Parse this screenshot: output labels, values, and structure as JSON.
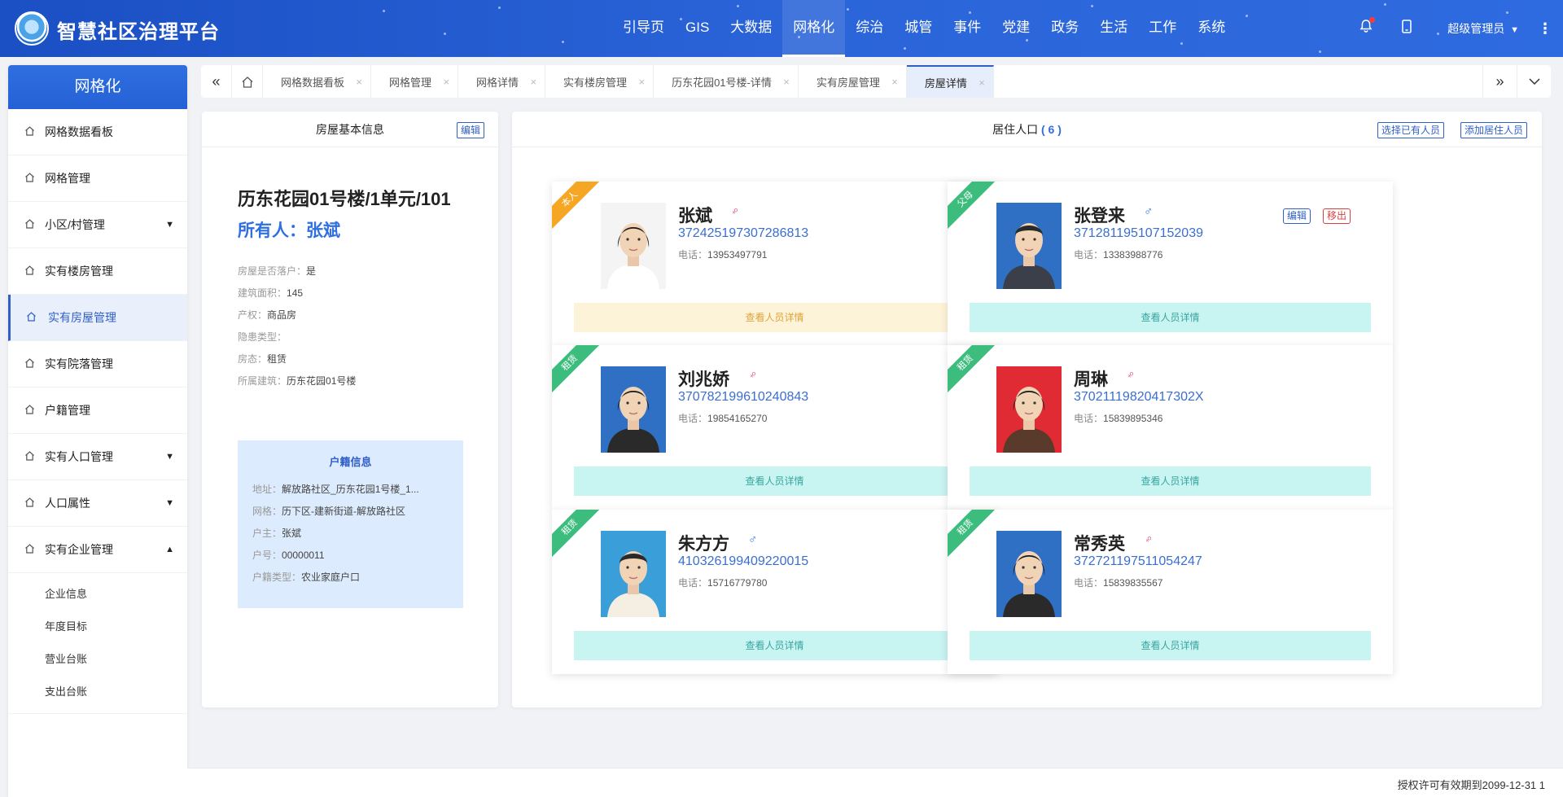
{
  "app": {
    "title": "智慧社区治理平台"
  },
  "top_nav": [
    {
      "label": "引导页"
    },
    {
      "label": "GIS"
    },
    {
      "label": "大数据"
    },
    {
      "label": "网格化"
    },
    {
      "label": "综治"
    },
    {
      "label": "城管"
    },
    {
      "label": "事件"
    },
    {
      "label": "党建"
    },
    {
      "label": "政务"
    },
    {
      "label": "生活"
    },
    {
      "label": "工作"
    },
    {
      "label": "系统"
    }
  ],
  "top_nav_active": "网格化",
  "user": {
    "label": "超级管理员"
  },
  "icons": {
    "bell": "bell-icon",
    "phone": "mobile-icon",
    "more": "more-vertical-icon",
    "home": "home-icon"
  },
  "sidebar": {
    "title": "网格化",
    "items": [
      {
        "label": "网格数据看板"
      },
      {
        "label": "网格管理"
      },
      {
        "label": "小区/村管理"
      },
      {
        "label": "实有楼房管理"
      },
      {
        "label": "实有房屋管理"
      },
      {
        "label": "实有院落管理"
      },
      {
        "label": "户籍管理"
      },
      {
        "label": "实有人口管理"
      },
      {
        "label": "人口属性"
      },
      {
        "label": "实有企业管理"
      }
    ],
    "sub_items": [
      {
        "label": "企业信息"
      },
      {
        "label": "年度目标"
      },
      {
        "label": "营业台账"
      },
      {
        "label": "支出台账"
      }
    ]
  },
  "tabs": [
    {
      "label": "网格数据看板"
    },
    {
      "label": "网格管理"
    },
    {
      "label": "网格详情"
    },
    {
      "label": "实有楼房管理"
    },
    {
      "label": "历东花园01号楼-详情"
    },
    {
      "label": "实有房屋管理"
    },
    {
      "label": "房屋详情"
    }
  ],
  "house": {
    "panel_title": "房屋基本信息",
    "edit_label": "编辑",
    "title": "历东花园01号楼/1单元/101",
    "owner": "所有人：张斌",
    "info": [
      {
        "label": "房屋是否落户：",
        "value": "是"
      },
      {
        "label": "建筑面积：",
        "value": "145"
      },
      {
        "label": "产权：",
        "value": "商品房"
      },
      {
        "label": "隐患类型：",
        "value": ""
      },
      {
        "label": "房态：",
        "value": "租赁"
      },
      {
        "label": "所属建筑：",
        "value": "历东花园01号楼"
      }
    ],
    "hukou": {
      "title": "户籍信息",
      "rows": [
        {
          "label": "地址：",
          "value": "解放路社区_历东花园1号楼_1..."
        },
        {
          "label": "网格：",
          "value": "历下区-建新街道-解放路社区"
        },
        {
          "label": "户主：",
          "value": "张斌"
        },
        {
          "label": "户号：",
          "value": "00000011"
        },
        {
          "label": "户籍类型：",
          "value": "农业家庭户口"
        }
      ]
    }
  },
  "residents": {
    "title": "居住人口",
    "count": "( 6 )",
    "select_existing": "选择已有人员",
    "add_resident": "添加居住人员",
    "detail_label": "查看人员详情",
    "edit_label": "编辑",
    "remove_label": "移出",
    "phone_label": "电话：",
    "list": [
      {
        "tag": "本人",
        "tag_color": "#f5a623",
        "name": "张斌",
        "gender": "female",
        "id": "372425197307286813",
        "phone": "13953497791"
      },
      {
        "tag": "父母",
        "tag_color": "#3dbd7d",
        "name": "张登来",
        "gender": "male",
        "id": "371281195107152039",
        "phone": "13383988776"
      },
      {
        "tag": "租赁",
        "tag_color": "#3dbd7d",
        "name": "刘兆娇",
        "gender": "female",
        "id": "370782199610240843",
        "phone": "19854165270"
      },
      {
        "tag": "租赁",
        "tag_color": "#3dbd7d",
        "name": "周琳",
        "gender": "female",
        "id": "37021119820417302X",
        "phone": "15839895346"
      },
      {
        "tag": "租赁",
        "tag_color": "#3dbd7d",
        "name": "朱方方",
        "gender": "male",
        "id": "410326199409220015",
        "phone": "15716779780"
      },
      {
        "tag": "租赁",
        "tag_color": "#3dbd7d",
        "name": "常秀英",
        "gender": "female",
        "id": "372721197511054247",
        "phone": "15839835567"
      }
    ]
  },
  "footer": {
    "license": "授权许可有效期到2099-12-31 1"
  }
}
